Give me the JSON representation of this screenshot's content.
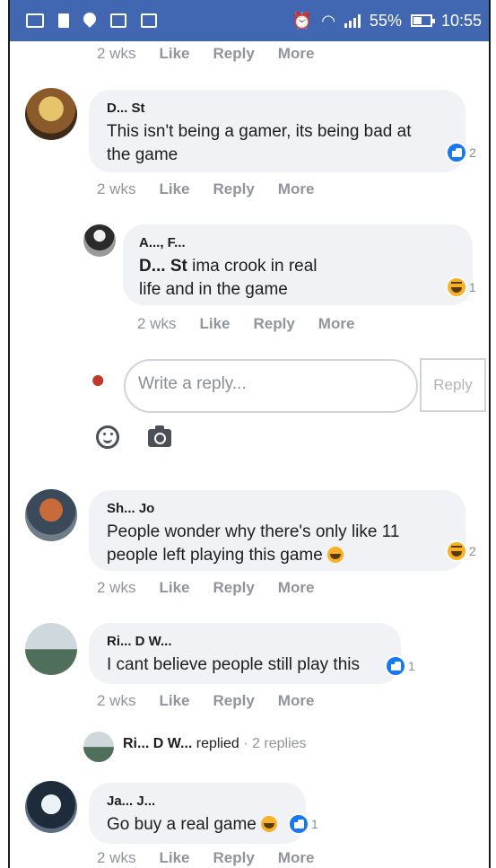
{
  "status_bar": {
    "battery": "55%",
    "time": "10:55",
    "bg": "#4267b2"
  },
  "top_actions": {
    "time": "2 wks",
    "like": "Like",
    "reply": "Reply",
    "more": "More"
  },
  "comments": [
    {
      "author": "D... St",
      "text_line1": "This isn't being a gamer, its being bad at",
      "text_line2": "the game",
      "reaction": "like",
      "count": "2",
      "actions": {
        "time": "2 wks",
        "like": "Like",
        "reply": "Reply",
        "more": "More"
      }
    },
    {
      "author": "A..., F...",
      "mention": "D... St",
      "text_after_mention": "ima crook in real",
      "text_line2": "life and in the game",
      "reaction": "haha",
      "count": "1",
      "actions": {
        "time": "2 wks",
        "like": "Like",
        "reply": "Reply",
        "more": "More"
      }
    },
    {
      "author": "Sh... Jo",
      "text_line1": "People wonder why there's only like 11",
      "text_line2": "people left playing this game",
      "reaction": "haha",
      "count": "2",
      "actions": {
        "time": "2 wks",
        "like": "Like",
        "reply": "Reply",
        "more": "More"
      }
    },
    {
      "author": "Ri... D W...",
      "text_line1": "I cant believe people still play this",
      "reaction": "like",
      "count": "1",
      "actions": {
        "time": "2 wks",
        "like": "Like",
        "reply": "Reply",
        "more": "More"
      }
    },
    {
      "author": "Ja... J...",
      "text_line1": "Go buy a real game",
      "reaction": "like",
      "count": "1",
      "actions": {
        "time": "2 wks",
        "like": "Like",
        "reply": "Reply",
        "more": "More"
      }
    }
  ],
  "reply_box": {
    "placeholder": "Write a reply...",
    "button": "Reply"
  },
  "replied": {
    "name": "Ri... D W...",
    "verb": "replied",
    "sep": "·",
    "count": "2 replies"
  }
}
